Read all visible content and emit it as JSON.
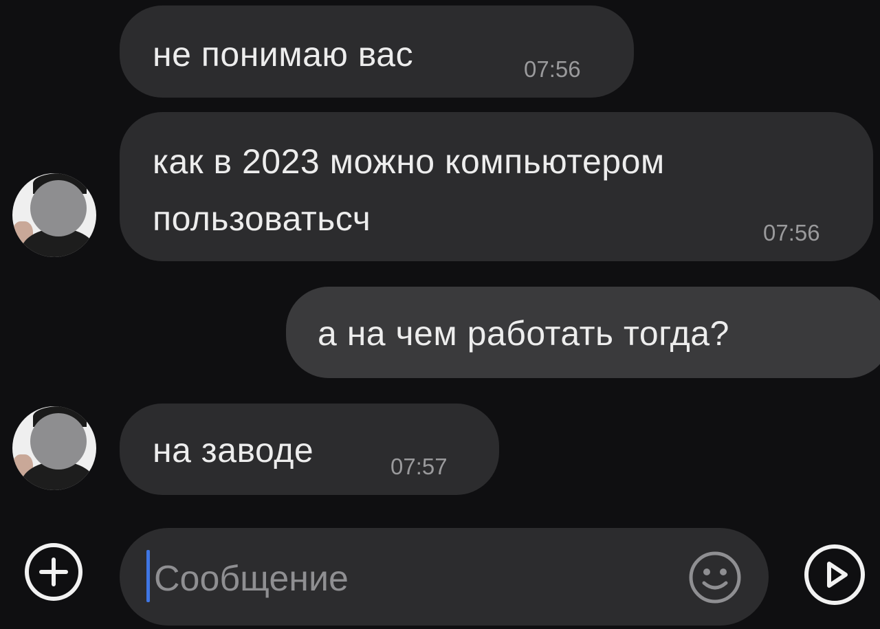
{
  "messages": [
    {
      "direction": "incoming",
      "text": "не понимаю вас",
      "time": "07:56"
    },
    {
      "direction": "incoming",
      "text_line1": "как в 2023 можно компьютером",
      "text_line2": "пользоватьсч",
      "time": "07:56"
    },
    {
      "direction": "outgoing",
      "text": "а на чем работать тогда?"
    },
    {
      "direction": "incoming",
      "text": "на заводе",
      "time": "07:57"
    }
  ],
  "composer": {
    "placeholder": "Сообщение",
    "attach_icon": "plus-circle-icon",
    "emoji_icon": "smiley-icon",
    "send_icon": "play-circle-icon"
  },
  "colors": {
    "background": "#0f0f11",
    "incoming_bubble": "#2c2c2e",
    "outgoing_bubble": "#3a3a3c",
    "caret": "#3f76e4"
  }
}
